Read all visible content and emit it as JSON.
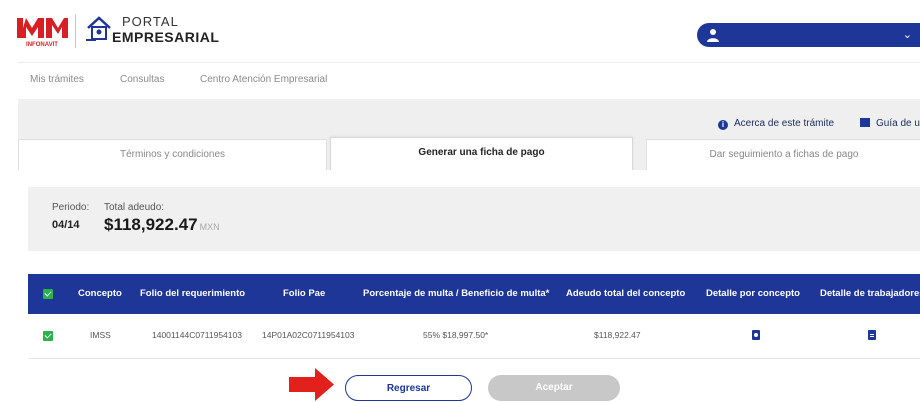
{
  "header": {
    "logo_caption": "INFONAVIT",
    "portal_line1": "PORTAL",
    "portal_line2": "EMPRESARIAL",
    "user_menu_chevron": "⌄",
    "brand_color": "#1d3697",
    "logo_red": "#d91f26"
  },
  "nav": {
    "items": [
      {
        "label": "Mis trámites"
      },
      {
        "label": "Consultas"
      },
      {
        "label": "Centro Atención Empresarial"
      }
    ]
  },
  "helpers": {
    "about": "Acerca de este trámite",
    "guide": "Guía de u"
  },
  "tabs": [
    {
      "label": "Términos y condiciones",
      "active": false
    },
    {
      "label": "Generar una ficha de pago",
      "active": true
    },
    {
      "label": "Dar seguimiento a fichas de pago",
      "active": false
    }
  ],
  "summary": {
    "periodo_label": "Periodo:",
    "periodo_value": "04/14",
    "total_label": "Total adeudo:",
    "total_value": "$118,922.47",
    "currency": "MXN"
  },
  "table": {
    "columns": [
      "Concepto",
      "Folio del requerimiento",
      "Folio Pae",
      "Porcentaje de multa / Beneficio de multa*",
      "Adeudo total del concepto",
      "Detalle por concepto",
      "Detalle de trabajadores"
    ],
    "rows": [
      {
        "checked": true,
        "concepto": "IMSS",
        "folio_requerimiento": "14001144C0711954103",
        "folio_pae": "14P01A02C0711954103",
        "porcentaje": "55% $18,997.50*",
        "adeudo": "$118,922.47",
        "detalle_concepto_icon": "document-search-icon",
        "detalle_trabajadores_icon": "document-icon"
      }
    ],
    "check_color": "#2ab24c"
  },
  "actions": {
    "back": "Regresar",
    "accept": "Aceptar",
    "arrow_color": "#e2201c"
  }
}
